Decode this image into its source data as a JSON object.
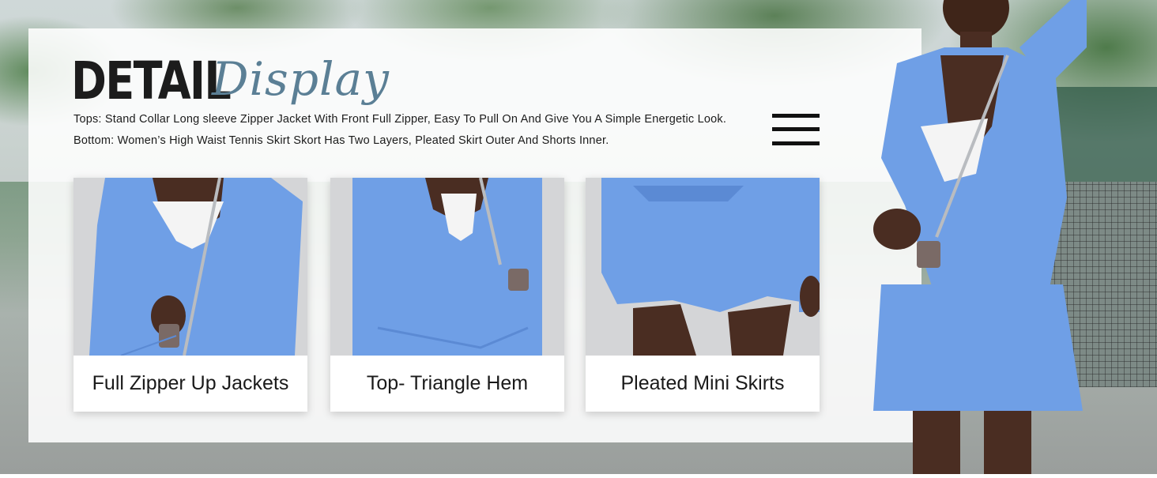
{
  "heading": {
    "bold": "DETAIL",
    "script": "Display"
  },
  "description": {
    "line1": "Tops: Stand Collar Long sleeve Zipper Jacket With Front Full Zipper, Easy To Pull On And Give You A Simple Energetic Look.",
    "line2": "Bottom: Women’s High Waist Tennis Skirt Skort Has Two Layers, Pleated Skirt Outer And Shorts Inner."
  },
  "cards": [
    {
      "caption": "Full Zipper Up Jackets"
    },
    {
      "caption": "Top- Triangle Hem"
    },
    {
      "caption": "Pleated Mini Skirts"
    }
  ],
  "icons": {
    "menu": "hamburger-menu-icon"
  },
  "colors": {
    "garment_blue": "#6f9fe6",
    "script_title": "#5b7f95",
    "panel": "#ffffff"
  }
}
